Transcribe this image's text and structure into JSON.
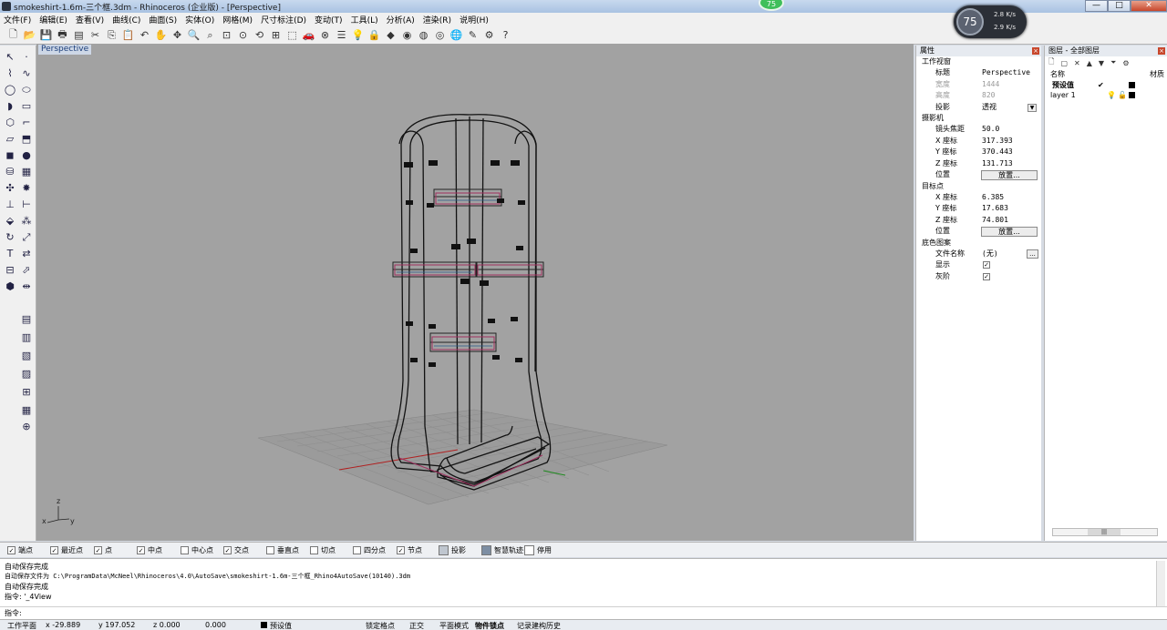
{
  "window": {
    "title": "smokeshirt-1.6m-三个框.3dm - Rhinoceros (企业版) - [Perspective]",
    "minimize": "—",
    "maximize": "□",
    "close": "✕",
    "notify_badge": "75"
  },
  "menu": [
    "文件(F)",
    "编辑(E)",
    "查看(V)",
    "曲线(C)",
    "曲面(S)",
    "实体(O)",
    "网格(M)",
    "尺寸标注(D)",
    "变动(T)",
    "工具(L)",
    "分析(A)",
    "渲染(R)",
    "说明(H)"
  ],
  "net_widget": {
    "percent": "75",
    "up": "2.8",
    "down": "2.9",
    "unit": "K/s"
  },
  "viewport": {
    "tab_label": "Perspective",
    "axis_z": "z",
    "axis_x": "x",
    "axis_y": "y"
  },
  "properties": {
    "panel_title": "属性",
    "section_view": "工作视窗",
    "title_label": "标题",
    "title_value": "Perspective",
    "width_label": "宽度",
    "width_value": "1444",
    "height_label": "高度",
    "height_value": "820",
    "projection_label": "投影",
    "projection_value": "透视",
    "section_camera": "摄影机",
    "focal_label": "镜头焦距",
    "focal_value": "50.0",
    "cam_x_label": "X 座标",
    "cam_x_value": "317.393",
    "cam_y_label": "Y 座标",
    "cam_y_value": "370.443",
    "cam_z_label": "Z 座标",
    "cam_z_value": "131.713",
    "cam_pos_label": "位置",
    "cam_pos_button": "放置...",
    "section_target": "目标点",
    "tgt_x_label": "X 座标",
    "tgt_x_value": "6.385",
    "tgt_y_label": "Y 座标",
    "tgt_y_value": "17.683",
    "tgt_z_label": "Z 座标",
    "tgt_z_value": "74.801",
    "tgt_pos_label": "位置",
    "tgt_pos_button": "放置...",
    "section_wallpaper": "底色图案",
    "file_label": "文件名称",
    "file_value": "(无)",
    "file_button": "...",
    "show_label": "显示",
    "gray_label": "灰阶"
  },
  "layers": {
    "panel_title": "图层 - 全部图层",
    "col_name": "名称",
    "col_material": "材质",
    "rows": [
      {
        "name": "预设值"
      },
      {
        "name": "layer 1"
      }
    ],
    "scroll_thumb": "|||"
  },
  "osnap": {
    "items": [
      {
        "label": "端点",
        "checked": "✓"
      },
      {
        "label": "最近点",
        "checked": "✓"
      },
      {
        "label": "点",
        "checked": "✓"
      },
      {
        "label": "中点",
        "checked": "✓"
      },
      {
        "label": "中心点",
        "checked": ""
      },
      {
        "label": "交点",
        "checked": "✓"
      },
      {
        "label": "垂直点",
        "checked": ""
      },
      {
        "label": "切点",
        "checked": ""
      },
      {
        "label": "四分点",
        "checked": ""
      },
      {
        "label": "节点",
        "checked": "✓"
      }
    ],
    "project_label": "投影",
    "smarttrack_label": "智慧轨迹",
    "pause_label": "停用"
  },
  "command": {
    "history": [
      "自动保存完成",
      "自动保存文件为 C:\\ProgramData\\McNeel\\Rhinoceros\\4.0\\AutoSave\\smokeshirt-1.6m-三个框_Rhino4AutoSave(10140).3dm",
      "自动保存完成",
      "指令: '_4View"
    ],
    "prompt": "指令:"
  },
  "status": {
    "cplane": "工作平面",
    "x": "x -29.889",
    "y": "y 197.052",
    "z": "z 0.000",
    "dist": "0.000",
    "layer": "预设值",
    "snap": "锁定格点",
    "ortho": "正交",
    "planar": "平面模式",
    "osnap": "物件锁点",
    "history": "记录建构历史"
  }
}
